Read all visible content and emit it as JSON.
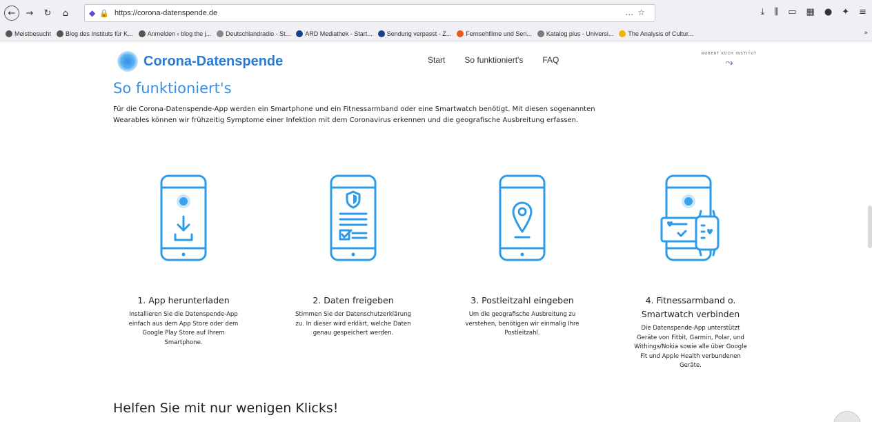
{
  "browser": {
    "url": "https://corona-datenspende.de",
    "toolbar_right_icons": [
      "download-icon",
      "library-icon",
      "sidebar-icon",
      "extension-icon",
      "account-icon",
      "gift-icon",
      "menu-icon"
    ],
    "bookmarks": [
      {
        "label": "Meistbesucht",
        "color": "#555555"
      },
      {
        "label": "Blog des Instituts für K...",
        "color": "#555555"
      },
      {
        "label": "Anmelden ‹ blog the j...",
        "color": "#555555"
      },
      {
        "label": "Deutschlandradio - St...",
        "color": "#888888"
      },
      {
        "label": "ARD Mediathek - Start...",
        "color": "#1a3f8f"
      },
      {
        "label": "Sendung verpasst - Z...",
        "color": "#1a3f8f"
      },
      {
        "label": "Fernsehfilme und Seri...",
        "color": "#e85a1a"
      },
      {
        "label": "Katalog plus - Universi...",
        "color": "#7a7a7a"
      },
      {
        "label": "The Analysis of Cultur...",
        "color": "#f0b400"
      }
    ],
    "bookmarks_more": "»"
  },
  "site": {
    "logo_text": "Corona-Datenspende",
    "nav": [
      "Start",
      "So funktioniert's",
      "FAQ"
    ],
    "rki_text": "ROBERT KOCH INSTITUT"
  },
  "content": {
    "title": "So funktioniert's",
    "intro": "Für die Corona-Datenspende-App werden ein Smartphone und ein Fitnessarmband oder eine Smartwatch benötigt. Mit diesen sogenannten Wearables können wir frühzeitig Symptome einer Infektion mit dem Coronavirus erkennen und die geografische Ausbreitung erfassen.",
    "steps": [
      {
        "title": "1. App herunterladen",
        "text": "Installieren Sie die Datenspende-App einfach aus dem App Store oder dem Google Play Store auf Ihrem Smartphone."
      },
      {
        "title": "2. Daten freigeben",
        "text": "Stimmen Sie der Datenschutzerklärung zu. In dieser wird erklärt, welche Daten genau gespeichert werden."
      },
      {
        "title": "3. Postleitzahl eingeben",
        "text": "Um die geografische Ausbreitung zu verstehen, benötigen wir einmalig Ihre Postleitzahl."
      },
      {
        "title": "4. Fitnessarmband o. Smartwatch verbinden",
        "text": "Die Datenspende-App unterstützt Geräte von Fitbit, Garmin, Polar, und Withings/Nokia sowie alle über Google Fit und Apple Health verbundenen Geräte."
      }
    ],
    "section_title": "Helfen Sie mit nur wenigen Klicks!"
  },
  "colors": {
    "accent": "#3b8fe0",
    "icon_stroke": "#2c9be8"
  }
}
